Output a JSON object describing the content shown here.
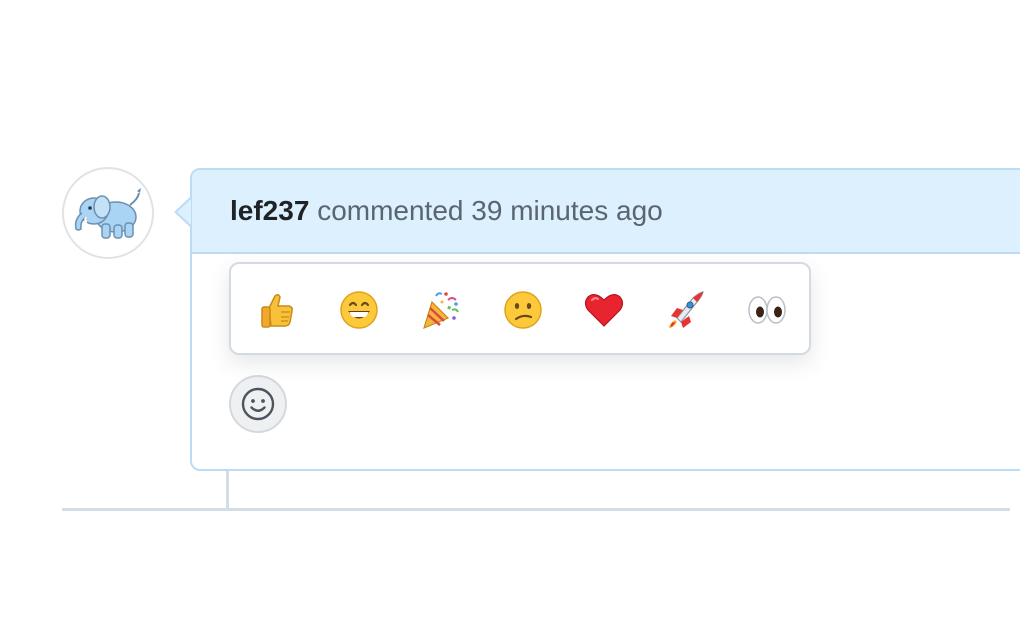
{
  "comment": {
    "author": "lef237",
    "action": "commented",
    "time": "39 minutes ago"
  },
  "avatar": {
    "icon": "elephant-avatar-icon"
  },
  "reactions": [
    {
      "name": "thumbs-up",
      "icon": "thumbs-up-icon"
    },
    {
      "name": "laugh",
      "icon": "grinning-face-icon"
    },
    {
      "name": "hooray",
      "icon": "party-popper-icon"
    },
    {
      "name": "confused",
      "icon": "confused-face-icon"
    },
    {
      "name": "heart",
      "icon": "heart-icon"
    },
    {
      "name": "rocket",
      "icon": "rocket-icon"
    },
    {
      "name": "eyes",
      "icon": "eyes-icon"
    }
  ],
  "add_reaction": {
    "icon": "smiley-icon"
  },
  "colors": {
    "header_bg": "#ddf0fd",
    "header_border": "#bcdcf5",
    "author_text": "#1f2328",
    "meta_text": "#5a6571"
  }
}
